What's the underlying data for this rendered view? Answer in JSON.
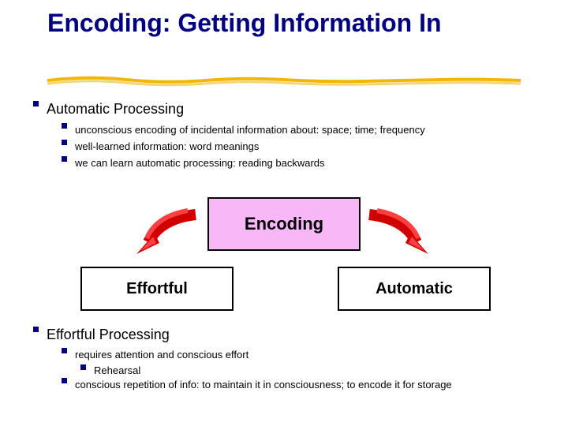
{
  "title": "Encoding: Getting Information In",
  "colors": {
    "accent": "#000080",
    "highlight": "#f8b8f8",
    "underline": "#f2b705"
  },
  "section1": {
    "heading": "Automatic Processing",
    "bullets": [
      "unconscious encoding of incidental information about: space; time; frequency",
      "well-learned information: word meanings",
      "we can learn automatic processing: reading backwards"
    ]
  },
  "diagram": {
    "center": "Encoding",
    "left": "Effortful",
    "right": "Automatic"
  },
  "section2": {
    "heading": "Effortful Processing",
    "bullets": [
      "requires attention and conscious effort",
      "Rehearsal",
      "conscious repetition of info: to maintain it in consciousness; to encode it for storage"
    ]
  }
}
